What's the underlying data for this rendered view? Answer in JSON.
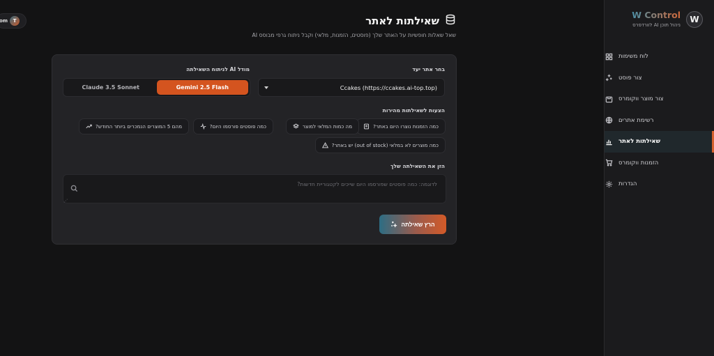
{
  "brand": {
    "title": "W Control",
    "subtitle": "ניהול תוכן AI לוורדפרס",
    "logo_letter": "W"
  },
  "user_chip": {
    "label": "om",
    "avatar_letter": "T"
  },
  "sidebar": {
    "items": [
      {
        "label": "לוח משימות",
        "icon": "dashboard-icon",
        "active": false
      },
      {
        "label": "צור פוסט",
        "icon": "sparkles-icon",
        "active": false
      },
      {
        "label": "צור מוצר ווקומרס",
        "icon": "product-box-icon",
        "active": false
      },
      {
        "label": "רשימת אתרים",
        "icon": "globe-icon",
        "active": false
      },
      {
        "label": "שאילתות לאתר",
        "icon": "bar-chart-icon",
        "active": true
      },
      {
        "label": "הזמנות ווקומרס",
        "icon": "cart-icon",
        "active": false
      },
      {
        "label": "הגדרות",
        "icon": "gear-icon",
        "active": false
      }
    ]
  },
  "header": {
    "title": "שאילתות לאתר",
    "title_icon": "database-icon",
    "subtitle": "שאל שאלות חופשיות על האתר שלך (פוסטים, הזמנות, מלאי) וקבל ניתוח גרפי מבוסס AI"
  },
  "form": {
    "site_label": "בחר אתר יעד",
    "site_value": "Ccakes (https://ccakes.ai-top.top)",
    "model_label": "מודל AI לניתוח השאילתה",
    "model_options": [
      "Gemini 2.5 Flash",
      "Claude 3.5 Sonnet"
    ],
    "model_selected": "Gemini 2.5 Flash",
    "suggestions_label": "הצעות לשאילתות מהירות",
    "suggestions": [
      {
        "label": "כמה הזמנות נוצרו היום באתר?",
        "icon": "receipt-icon"
      },
      {
        "label": "מה כמות המלאי למוצר",
        "icon": "layers-icon"
      },
      {
        "label": "כמה פוסטים פורסמו היום?",
        "icon": "activity-icon"
      },
      {
        "label": "מהם 5 המוצרים הנמכרים ביותר החודש?",
        "icon": "trending-up-icon"
      },
      {
        "label": "כמה מוצרים לא במלאי (out of stock) יש באתר?",
        "icon": "alert-triangle-icon"
      }
    ],
    "query_label": "הזן את השאילתה שלך",
    "query_placeholder": "לדוגמה: כמה פוסטים שפורסמו היום שייכים לקטגוריית חדשות?",
    "query_value": "",
    "run_button": "הרץ שאילתה"
  },
  "colors": {
    "background": "#131314",
    "sidebar": "#1b1b1d",
    "card": "#232326",
    "accent_orange": "#d4541f",
    "accent_teal": "#2d6d84"
  }
}
